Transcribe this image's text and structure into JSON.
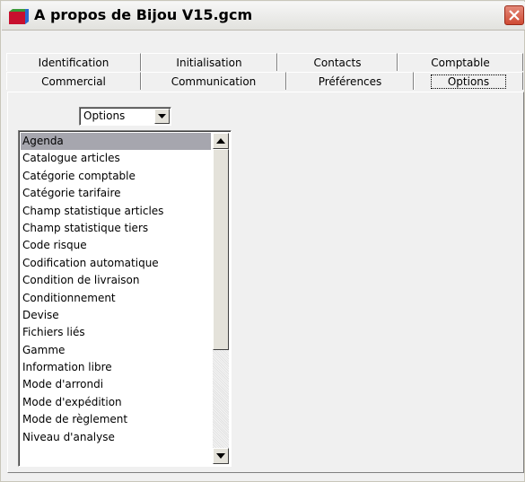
{
  "window": {
    "title": "A propos de Bijou V15.gcm",
    "app_icon": "colored-cube-icon",
    "close_icon": "close-icon",
    "colors": {
      "close_button": "#d85b45",
      "title_bar": "#eeeeea",
      "selected_item": "#a6a6ae"
    }
  },
  "tabs": {
    "row1": [
      "Identification",
      "Initialisation",
      "Contacts",
      "Comptable"
    ],
    "row2": [
      "Commercial",
      "Communication",
      "Préférences",
      "Options"
    ],
    "active": "Options"
  },
  "options_panel": {
    "combo_value": "Options",
    "combo_icon": "chevron-down-icon",
    "list_items": [
      "Agenda",
      "Catalogue articles",
      "Catégorie comptable",
      "Catégorie tarifaire",
      "Champ statistique articles",
      "Champ statistique tiers",
      "Code risque",
      "Codification automatique",
      "Condition de livraison",
      "Conditionnement",
      "Devise",
      "Fichiers liés",
      "Gamme",
      "Information libre",
      "Mode d'arrondi",
      "Mode d'expédition",
      "Mode de règlement",
      "Niveau d'analyse"
    ],
    "selected_item": "Agenda",
    "scroll_up_icon": "arrow-up-icon",
    "scroll_down_icon": "arrow-down-icon"
  }
}
